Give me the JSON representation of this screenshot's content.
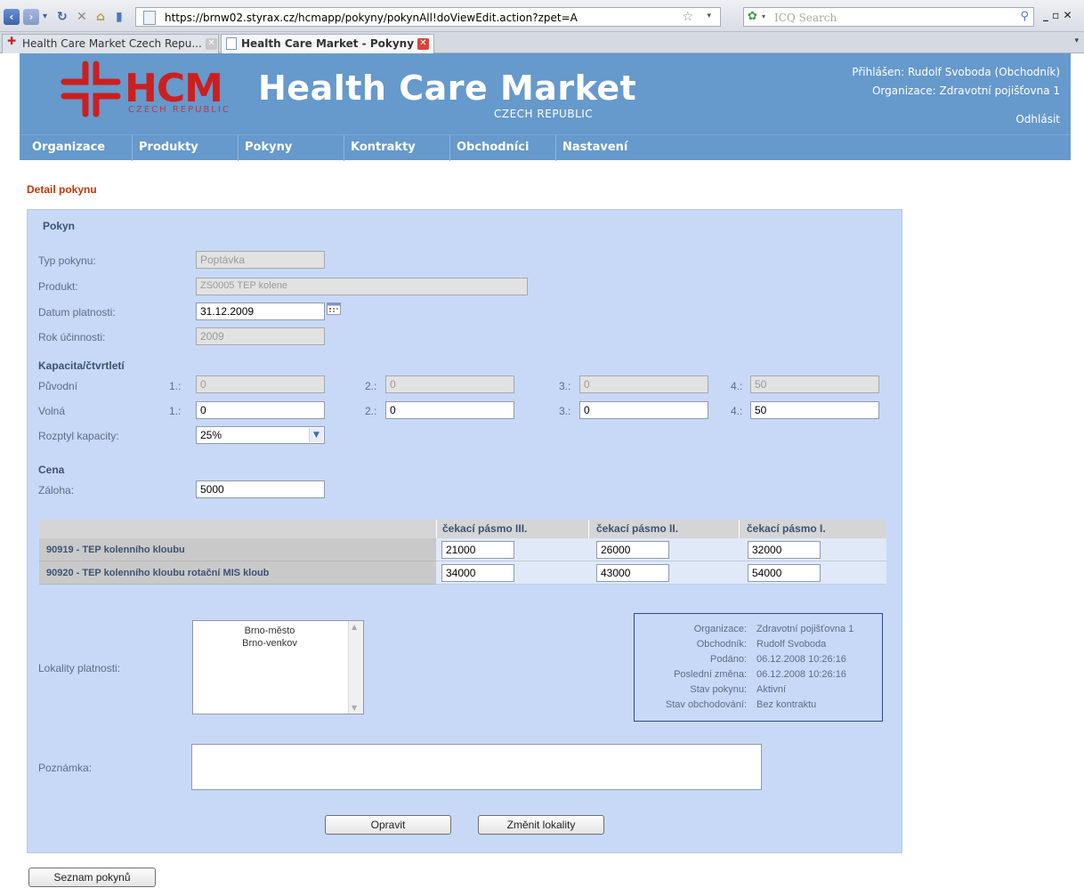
{
  "browser": {
    "url": "https://brnw02.styrax.cz/hcmapp/pokyny/pokynAll!doViewEdit.action?zpet=A",
    "search_placeholder": "ICQ Search",
    "window_controls": "_ ▫ ✕",
    "tabs": [
      {
        "label": "Health Care Market Czech Repu...",
        "active": false
      },
      {
        "label": "Health Care Market - Pokyny",
        "active": true
      }
    ]
  },
  "header": {
    "logo_text": "HCM",
    "logo_sub": "CZECH REPUBLIC",
    "brand_title": "Health Care Market",
    "brand_subtitle": "CZECH REPUBLIC",
    "user_line": "Přihlášen: Rudolf Svoboda (Obchodník)",
    "org_line": "Organizace: Zdravotní pojišťovna 1",
    "logout": "Odhlásit",
    "nav": [
      "Organizace",
      "Produkty",
      "Pokyny",
      "Kontrakty",
      "Obchodníci",
      "Nastavení"
    ]
  },
  "page": {
    "title": "Detail pokynu"
  },
  "form": {
    "section_pokyn": "Pokyn",
    "typ_label": "Typ pokynu:",
    "typ_value": "Poptávka",
    "produkt_label": "Produkt:",
    "produkt_value": "ZS0005 TEP kolene",
    "datum_label": "Datum platnosti:",
    "datum_value": "31.12.2009",
    "rok_label": "Rok účinnosti:",
    "rok_value": "2009",
    "section_kapacita": "Kapacita/čtvrtletí",
    "puvodni_label": "Původní",
    "volna_label": "Volná",
    "q_labels": [
      "1.:",
      "2.:",
      "3.:",
      "4.:"
    ],
    "puvodni_values": [
      "0",
      "0",
      "0",
      "50"
    ],
    "volna_values": [
      "0",
      "0",
      "0",
      "50"
    ],
    "rozptyl_label": "Rozptyl kapacity:",
    "rozptyl_value": "25%",
    "section_cena": "Cena",
    "zaloha_label": "Záloha:",
    "zaloha_value": "5000"
  },
  "price_table": {
    "headers": [
      "čekací pásmo III.",
      "čekací pásmo II.",
      "čekací pásmo I."
    ],
    "rows": [
      {
        "label": "90919 - TEP kolenního kloubu",
        "values": [
          "21000",
          "26000",
          "32000"
        ]
      },
      {
        "label": "90920 - TEP kolenního kloubu rotační MIS kloub",
        "values": [
          "34000",
          "43000",
          "54000"
        ]
      }
    ]
  },
  "lokality": {
    "label": "Lokality platnosti:",
    "items": [
      "Brno-město",
      "Brno-venkov"
    ]
  },
  "info": {
    "keys": [
      "Organizace:",
      "Obchodník:",
      "Podáno:",
      "Poslední změna:",
      "Stav pokynu:",
      "Stav obchodování:"
    ],
    "values": [
      "Zdravotní pojišťovna 1",
      "Rudolf Svoboda",
      "06.12.2008 10:26:16",
      "06.12.2008 10:26:16",
      "Aktivní",
      "Bez kontraktu"
    ]
  },
  "note": {
    "label": "Poznámka:",
    "value": ""
  },
  "buttons": {
    "opravit": "Opravit",
    "zmenit_lokality": "Změnit lokality",
    "seznam_pokynu": "Seznam pokynů"
  },
  "colors": {
    "header_bg": "#6699cc",
    "panel_bg": "#c7d9f7",
    "title_red": "#cc3300",
    "logo_red": "#cc1f1f"
  }
}
